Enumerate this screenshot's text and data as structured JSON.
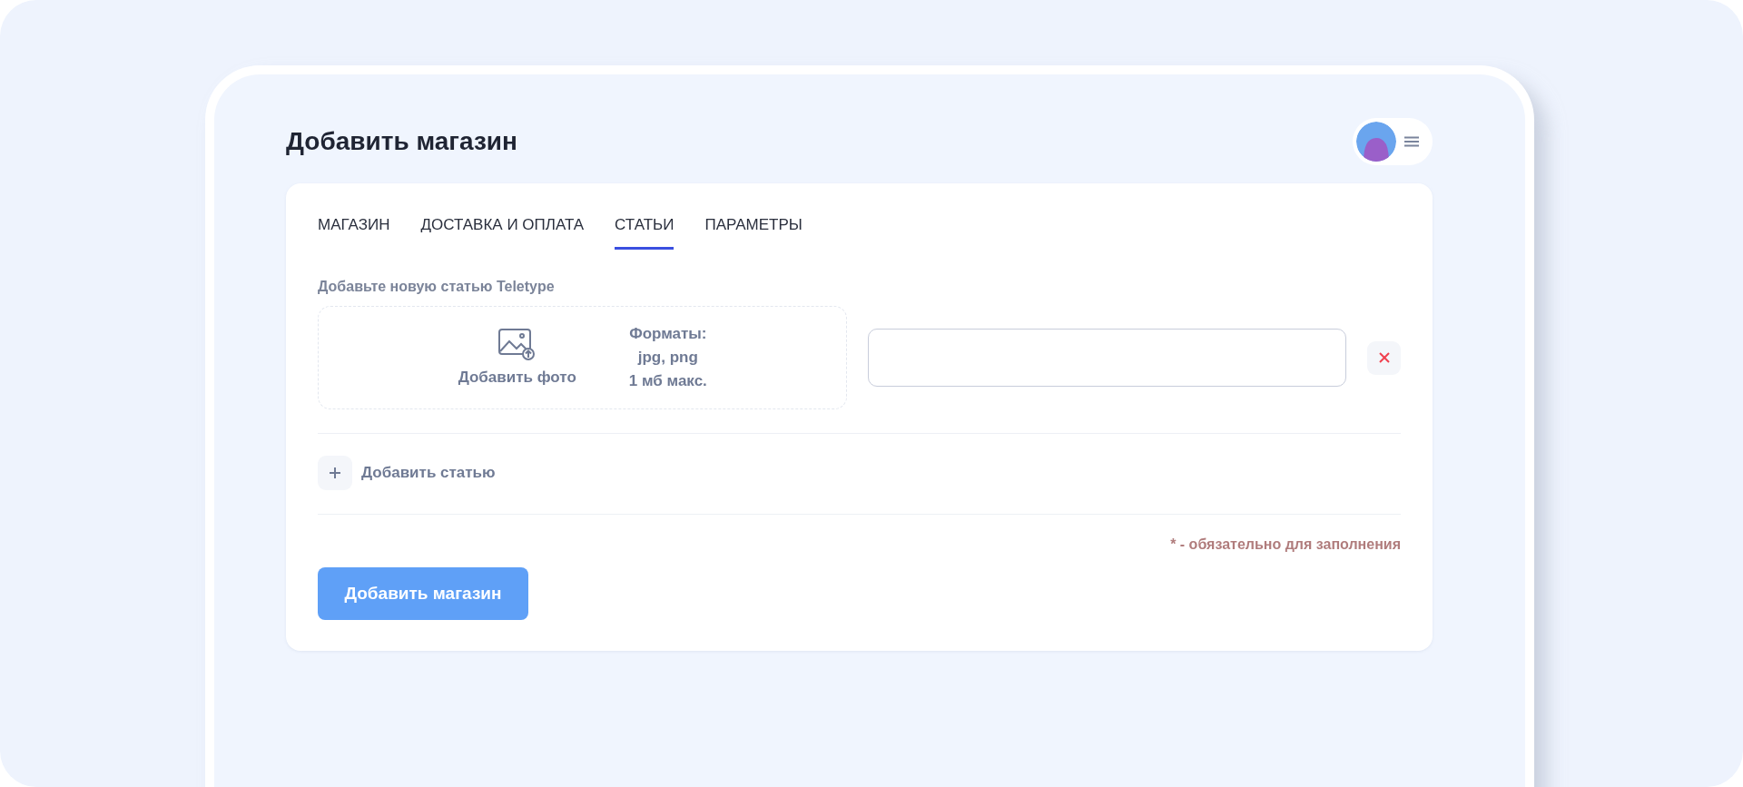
{
  "page_title": "Добавить магазин",
  "tabs": [
    {
      "label": "МАГАЗИН",
      "selected": false
    },
    {
      "label": "ДОСТАВКА И ОПЛАТА",
      "selected": false
    },
    {
      "label": "СТАТЬИ",
      "selected": true
    },
    {
      "label": "ПАРАМЕТРЫ",
      "selected": false
    }
  ],
  "section_label": "Добавьте новую статью Teletype",
  "upload": {
    "label": "Добавить фото",
    "formats": [
      "Форматы:",
      "jpg, png",
      "1 мб макс."
    ]
  },
  "add_article": "Добавить статью",
  "required_note": "* - обязательно для заполнения",
  "submit": "Добавить магазин"
}
